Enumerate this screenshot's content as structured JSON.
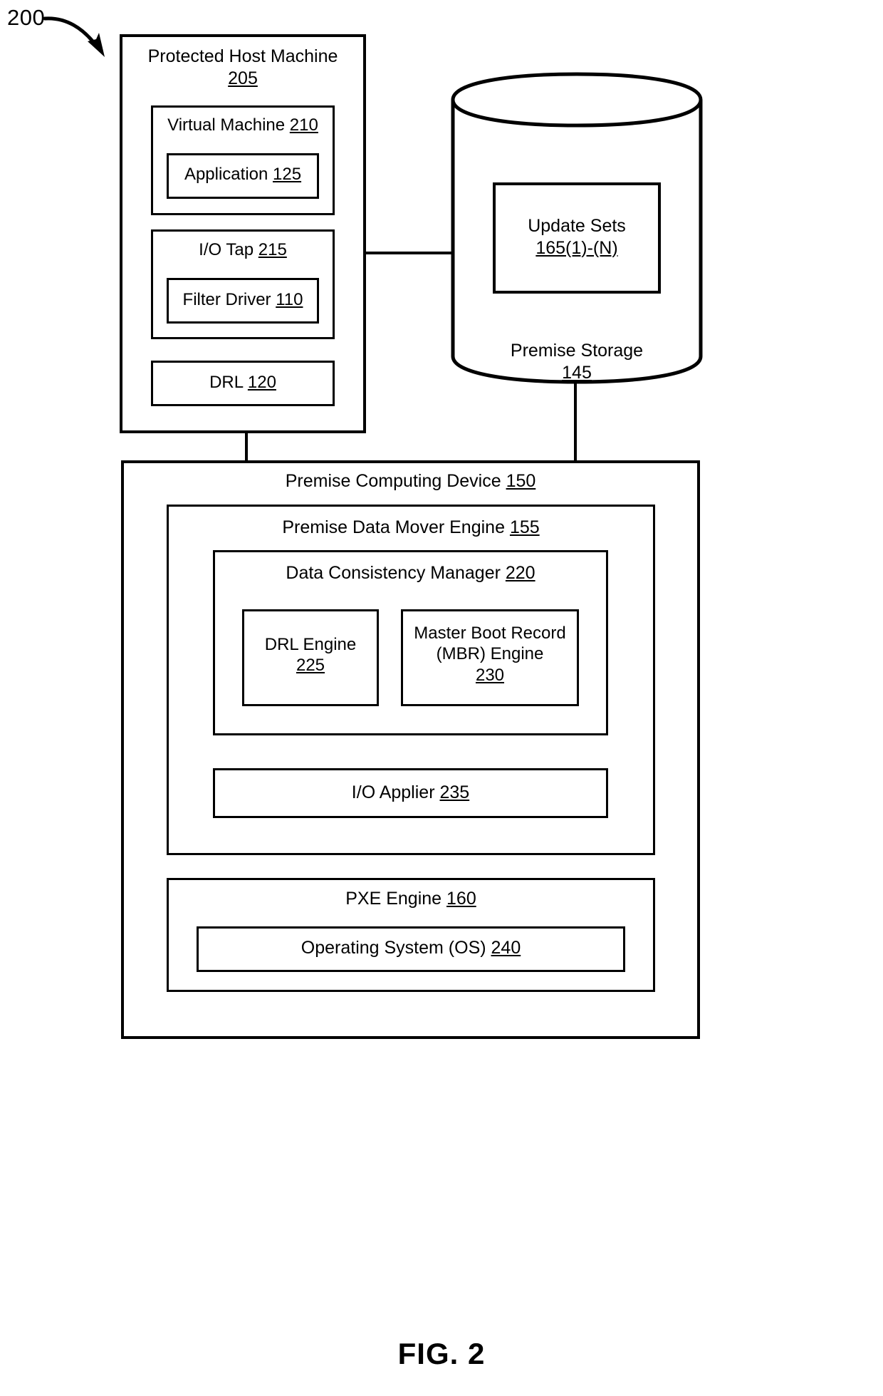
{
  "figure": {
    "reference_numeral": "200",
    "caption": "FIG. 2"
  },
  "host_machine": {
    "title": "Protected Host Machine",
    "ref": "205",
    "virtual_machine": {
      "title": "Virtual Machine ",
      "ref": "210",
      "application": {
        "title": "Application ",
        "ref": "125"
      }
    },
    "io_tap": {
      "title": "I/O Tap ",
      "ref": "215",
      "filter_driver": {
        "title": "Filter Driver ",
        "ref": "110"
      }
    },
    "drl": {
      "title": "DRL ",
      "ref": "120"
    }
  },
  "premise_storage": {
    "title": "Premise Storage",
    "ref": "145",
    "update_sets": {
      "title": "Update Sets",
      "ref": "165(1)-(N)"
    }
  },
  "premise_computing_device": {
    "title": "Premise Computing Device ",
    "ref": "150",
    "data_mover_engine": {
      "title": "Premise Data Mover Engine ",
      "ref": "155",
      "data_consistency_manager": {
        "title": "Data Consistency Manager ",
        "ref": "220",
        "drl_engine": {
          "title": "DRL Engine",
          "ref": "225"
        },
        "mbr_engine": {
          "title": "Master Boot Record\n(MBR) Engine",
          "ref": "230"
        }
      },
      "io_applier": {
        "title": "I/O Applier ",
        "ref": "235"
      }
    },
    "pxe_engine": {
      "title": "PXE Engine ",
      "ref": "160",
      "operating_system": {
        "title": "Operating System (OS) ",
        "ref": "240"
      }
    }
  },
  "colors": {
    "stroke": "#000000",
    "background": "#ffffff"
  }
}
